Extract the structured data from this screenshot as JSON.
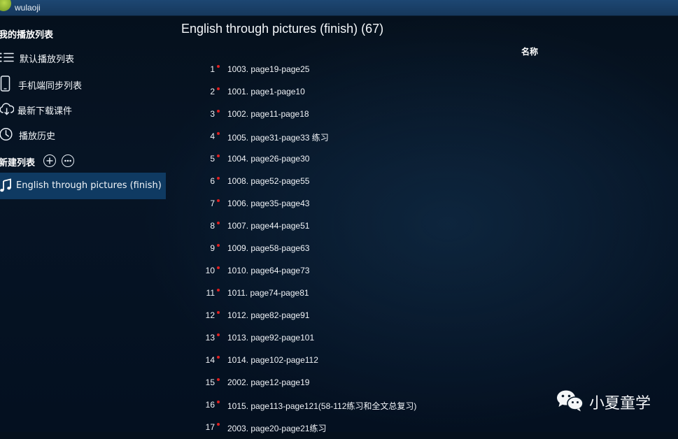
{
  "user": {
    "name": "wulaoji"
  },
  "sidebar": {
    "my_playlists_title": "我的播放列表",
    "items": [
      {
        "label": "默认播放列表",
        "icon": "list-icon"
      },
      {
        "label": "手机端同步列表",
        "icon": "phone-icon"
      },
      {
        "label": "最新下载课件",
        "icon": "download-cloud-icon"
      },
      {
        "label": "播放历史",
        "icon": "clock-icon"
      }
    ],
    "new_list_title": "新建列表",
    "custom_lists": [
      {
        "label": "English through pictures (finish)",
        "icon": "music-note-icon",
        "active": true
      }
    ]
  },
  "main": {
    "title": "English through pictures (finish) (67)",
    "column_header": "名称",
    "tracks": [
      {
        "num": "1",
        "name": "1003. page19-page25"
      },
      {
        "num": "2",
        "name": "1001. page1-page10"
      },
      {
        "num": "3",
        "name": "1002. page11-page18"
      },
      {
        "num": "4",
        "name": "1005. page31-page33 练习"
      },
      {
        "num": "5",
        "name": "1004. page26-page30"
      },
      {
        "num": "6",
        "name": "1008. page52-page55"
      },
      {
        "num": "7",
        "name": "1006. page35-page43"
      },
      {
        "num": "8",
        "name": "1007. page44-page51"
      },
      {
        "num": "9",
        "name": "1009. page58-page63"
      },
      {
        "num": "10",
        "name": "1010. page64-page73"
      },
      {
        "num": "11",
        "name": "1011. page74-page81"
      },
      {
        "num": "12",
        "name": "1012. page82-page91"
      },
      {
        "num": "13",
        "name": "1013. page92-page101"
      },
      {
        "num": "14",
        "name": "1014. page102-page112"
      },
      {
        "num": "15",
        "name": "2002. page12-page19"
      },
      {
        "num": "16",
        "name": "1015. page113-page121(58-112练习和全文总复习)"
      },
      {
        "num": "17",
        "name": "2003. page20-page21练习"
      }
    ]
  },
  "watermark": {
    "text": "小夏童学",
    "icon": "wechat-icon"
  },
  "colors": {
    "accent": "#0f3a62",
    "topbar": "#1d4773",
    "background": "#061425",
    "status_dot": "#e02020"
  }
}
